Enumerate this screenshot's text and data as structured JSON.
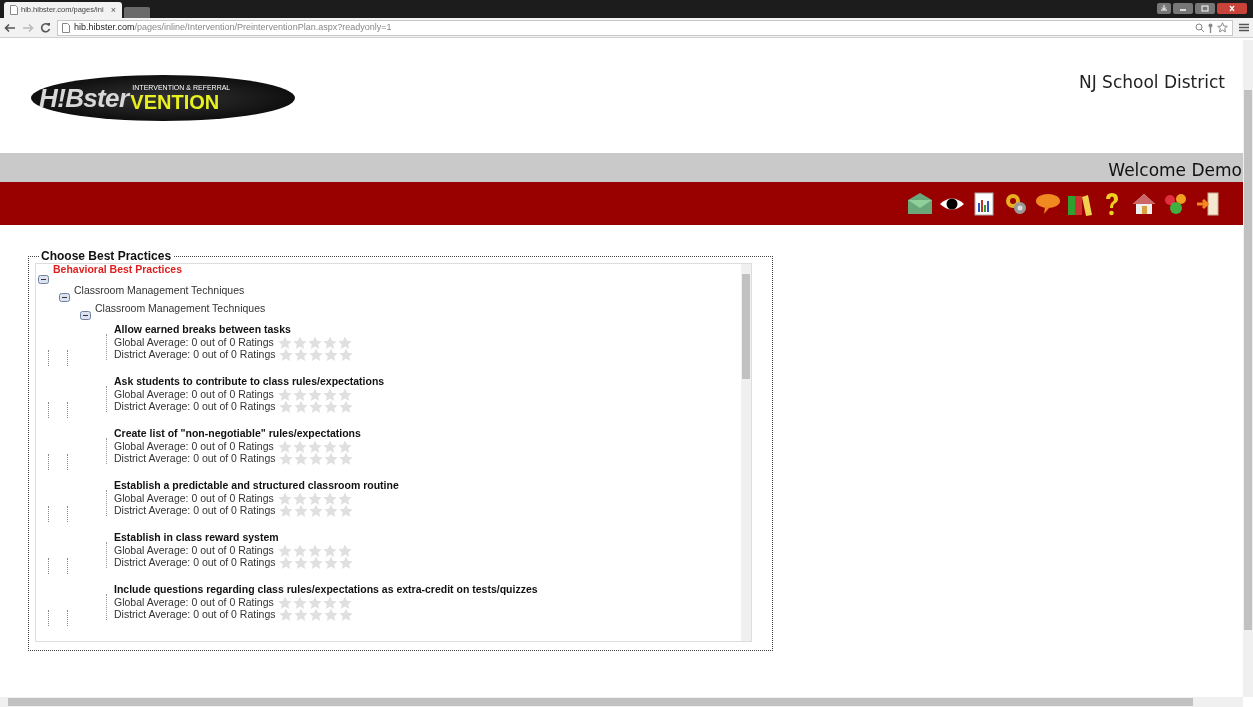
{
  "browser": {
    "tab_title": "hib.hibster.com/pages/ini",
    "tab_close": "×",
    "url_host": "hib.hibster.com",
    "url_path": "/pages/inline/Intervention/PreinterventionPlan.aspx?readyonly=1"
  },
  "header": {
    "logo": {
      "main": "H!Bster",
      "tagline": "INTERVENTION & REFERRAL",
      "suffix": "VENTION"
    },
    "district": "NJ School District",
    "welcome": "Welcome Demo"
  },
  "toolbar": [
    {
      "kind": "mail"
    },
    {
      "kind": "eye"
    },
    {
      "kind": "chart"
    },
    {
      "kind": "gears"
    },
    {
      "kind": "speech"
    },
    {
      "kind": "books"
    },
    {
      "kind": "help"
    },
    {
      "kind": "home"
    },
    {
      "kind": "blocks"
    },
    {
      "kind": "exit"
    }
  ],
  "best_practices": {
    "legend": "Choose Best Practices",
    "tree": [
      {
        "label": "Behavioral Best Practices",
        "expanded": true,
        "children": [
          {
            "label": "Classroom Management Techniques",
            "expanded": true,
            "children": [
              {
                "label": "Classroom Management Techniques",
                "expanded": true,
                "practices": [
                  {
                    "title": "Allow earned breaks between tasks",
                    "ratings": [
                      {
                        "text": "Global Average: 0 out of 0 Ratings",
                        "stars": 0
                      },
                      {
                        "text": "District Average: 0 out of 0 Ratings",
                        "stars": 0
                      }
                    ]
                  },
                  {
                    "title": "Ask students to contribute to class rules/expectations",
                    "ratings": [
                      {
                        "text": "Global Average: 0 out of 0 Ratings",
                        "stars": 0
                      },
                      {
                        "text": "District Average: 0 out of 0 Ratings",
                        "stars": 0
                      }
                    ]
                  },
                  {
                    "title": "Create list of \"non-negotiable\" rules/expectations",
                    "ratings": [
                      {
                        "text": "Global Average: 0 out of 0 Ratings",
                        "stars": 0
                      },
                      {
                        "text": "District Average: 0 out of 0 Ratings",
                        "stars": 0
                      }
                    ]
                  },
                  {
                    "title": "Establish a predictable and structured classroom routine",
                    "ratings": [
                      {
                        "text": "Global Average: 0 out of 0 Ratings",
                        "stars": 0
                      },
                      {
                        "text": "District Average: 0 out of 0 Ratings",
                        "stars": 0
                      }
                    ]
                  },
                  {
                    "title": "Establish in class reward system",
                    "ratings": [
                      {
                        "text": "Global Average: 0 out of 0 Ratings",
                        "stars": 0
                      },
                      {
                        "text": "District Average: 0 out of 0 Ratings",
                        "stars": 0
                      }
                    ]
                  },
                  {
                    "title": "Include questions regarding class rules/expectations as extra-credit on tests/quizzes",
                    "ratings": [
                      {
                        "text": "Global Average: 0 out of 0 Ratings",
                        "stars": 0
                      },
                      {
                        "text": "District Average: 0 out of 0 Ratings",
                        "stars": 0
                      }
                    ]
                  }
                ]
              }
            ]
          }
        ]
      }
    ]
  }
}
